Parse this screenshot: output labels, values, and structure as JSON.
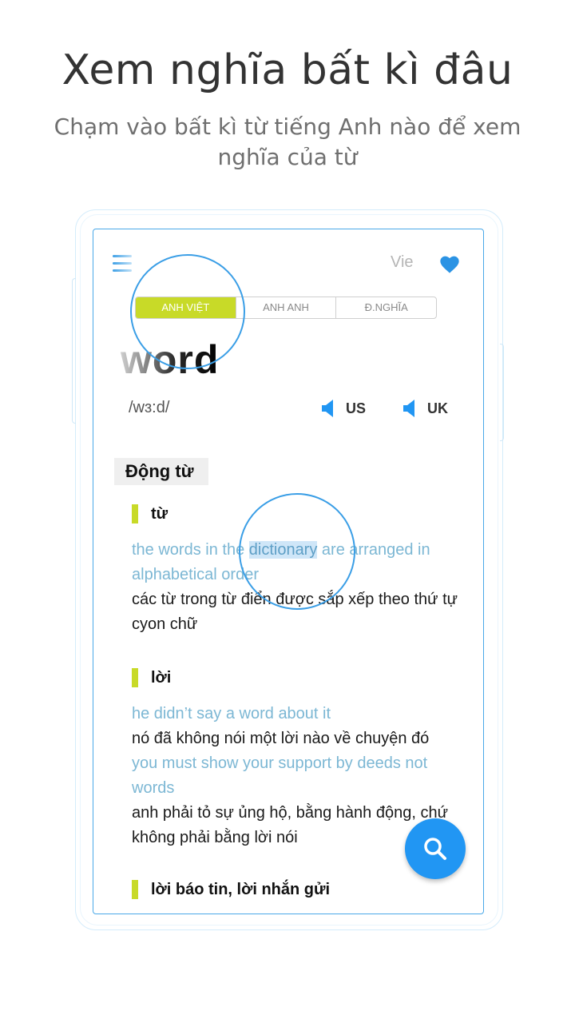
{
  "header": {
    "title": "Xem nghĩa bất kì đâu",
    "subtitle": "Chạm vào bất kì từ tiếng Anh nào để xem nghĩa của từ"
  },
  "app": {
    "language_label": "Vie",
    "tabs": [
      {
        "label": "ANH VIỆT",
        "active": true
      },
      {
        "label": "ANH ANH",
        "active": false
      },
      {
        "label": "Đ.NGHĨA",
        "active": false
      }
    ],
    "word": "word",
    "phonetic": "/wɜ:d/",
    "audio": [
      {
        "label": "US"
      },
      {
        "label": "UK"
      }
    ],
    "part_of_speech": "Động từ",
    "senses": [
      {
        "label": "từ",
        "example_en_before": "the words in the ",
        "example_en_highlight": "dictionary",
        "example_en_after": " are arranged in alphabetical order",
        "example_vi": "các từ trong từ điển được sắp xếp theo thứ tự cyon chữ"
      },
      {
        "label": "lời",
        "examples": [
          {
            "en": "he didn’t say a word about it",
            "vi": "nó đã không nói một lời nào về chuyện đó"
          },
          {
            "en": "you must show your support by deeds not words",
            "vi": "anh phải tỏ sự ủng hộ, bằng hành động, chứ không phải bằng lời nói"
          }
        ]
      },
      {
        "label": "lời báo tin, lời nhắn gửi"
      }
    ]
  },
  "colors": {
    "accent_blue": "#2196f3",
    "accent_green": "#c8da28",
    "example_text": "#7cb7d4"
  },
  "icons": {
    "menu": "menu-icon",
    "favorite": "heart-icon",
    "speaker": "speaker-icon",
    "search": "search-icon"
  }
}
